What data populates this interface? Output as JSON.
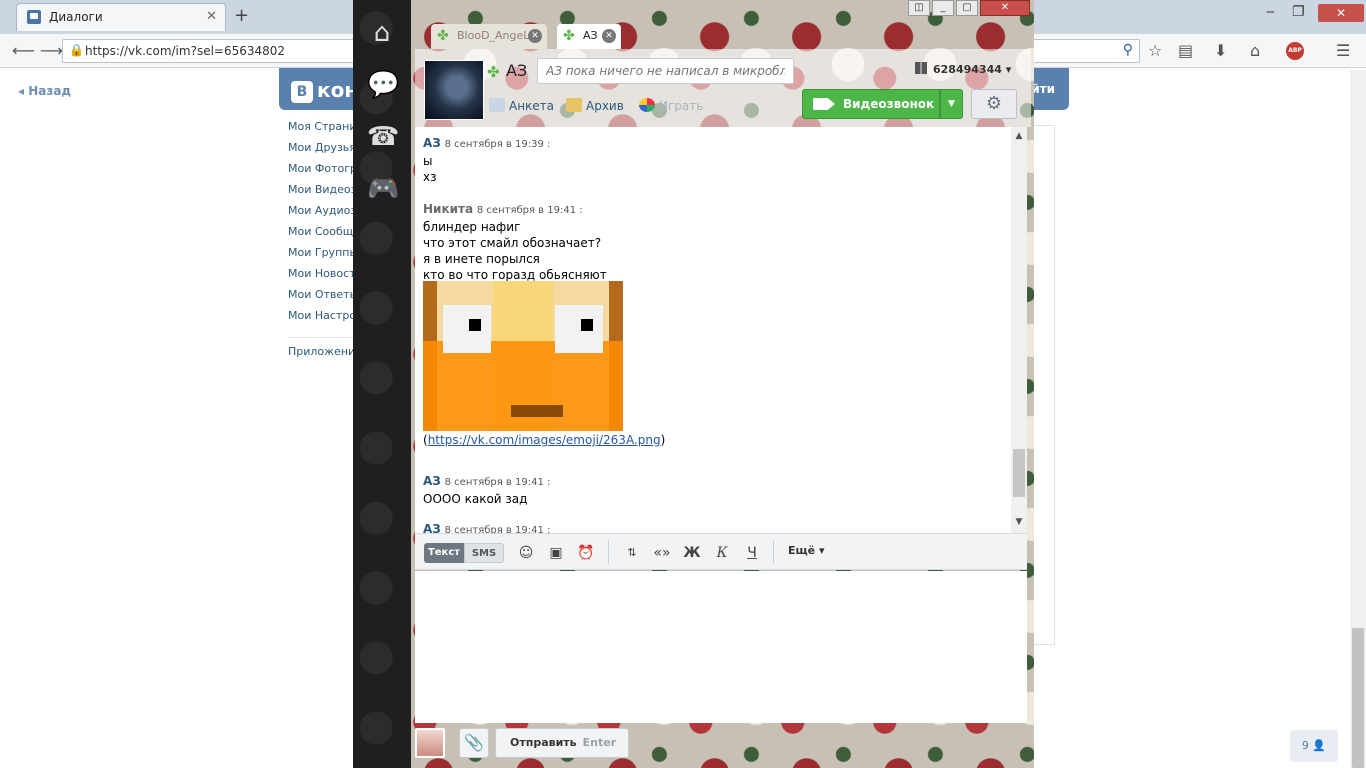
{
  "browser": {
    "tab_title": "Диалоги",
    "tab_close": "✕",
    "new_tab": "+",
    "url": "https://vk.com/im?sel=65634802"
  },
  "vk": {
    "back_label": "Назад",
    "logo_text": "кон",
    "logo_b": "В",
    "exit_label": "йти",
    "menu": [
      "Моя Страни",
      "Мои Друзья",
      "Мои Фотогра",
      "Мои Видеоза",
      "Мои Аудиоза",
      "Мои Сообще",
      "Мои Группы",
      "Мои Новости",
      "Мои Ответы",
      "Мои Настрой"
    ],
    "apps_label": "Приложения",
    "online_count": "9"
  },
  "messenger": {
    "tabs": [
      {
        "label": "BlooD_AngeL"
      },
      {
        "label": "АЗ"
      }
    ],
    "contact": {
      "name": "АЗ",
      "status_placeholder": "АЗ пока ничего не написал в микроблог",
      "uin": "628494344",
      "links": {
        "profile": "Анкета",
        "archive": "Архив",
        "games": "Играть"
      }
    },
    "videocall_label": "Видеозвонок",
    "messages": [
      {
        "author": "АЗ",
        "time": "8 сентября в 19:39 :",
        "lines": [
          "ы",
          "хз"
        ]
      },
      {
        "author": "Никита",
        "time": "8 сентября в 19:41 :",
        "lines": [
          "блиндер нафиг",
          "что этот смайл обозначает?",
          "я в инете порылся",
          "кто во что горазд обьясняют"
        ]
      },
      {
        "author": "АЗ",
        "time": "8 сентября в 19:41 :",
        "lines": [
          "ОООО какой зад"
        ]
      },
      {
        "author": "АЗ",
        "time": "8 сентября в 19:41 :",
        "lines": []
      }
    ],
    "emoji_link": "https://vk.com/images/emoji/263A.png",
    "toolbar": {
      "mode_text": "Текст",
      "mode_sms": "SMS",
      "bold": "Ж",
      "italic": "К",
      "underline": "Ч",
      "quotes": "«»",
      "more": "Ещё"
    },
    "send_label": "Отправить",
    "send_hint": "Enter"
  }
}
